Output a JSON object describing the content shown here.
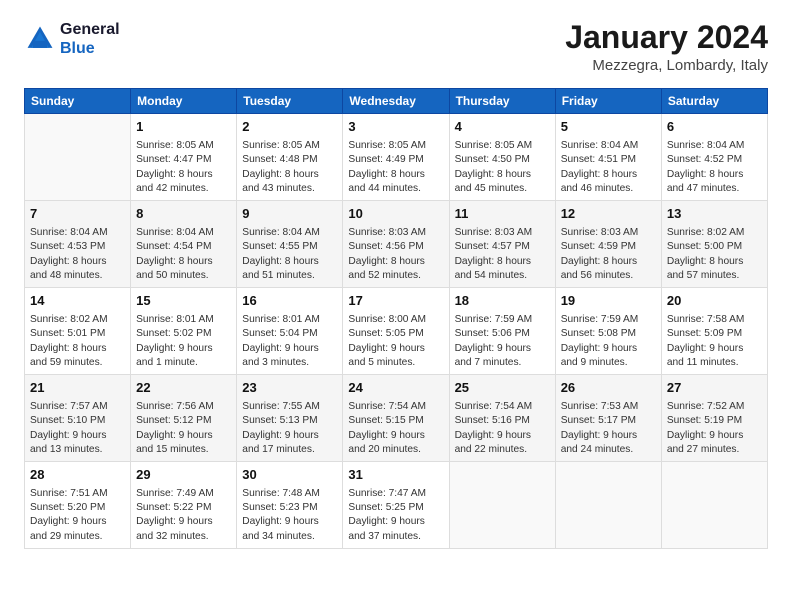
{
  "logo": {
    "line1": "General",
    "line2": "Blue"
  },
  "title": "January 2024",
  "location": "Mezzegra, Lombardy, Italy",
  "weekdays": [
    "Sunday",
    "Monday",
    "Tuesday",
    "Wednesday",
    "Thursday",
    "Friday",
    "Saturday"
  ],
  "weeks": [
    [
      {
        "day": "",
        "info": ""
      },
      {
        "day": "1",
        "info": "Sunrise: 8:05 AM\nSunset: 4:47 PM\nDaylight: 8 hours\nand 42 minutes."
      },
      {
        "day": "2",
        "info": "Sunrise: 8:05 AM\nSunset: 4:48 PM\nDaylight: 8 hours\nand 43 minutes."
      },
      {
        "day": "3",
        "info": "Sunrise: 8:05 AM\nSunset: 4:49 PM\nDaylight: 8 hours\nand 44 minutes."
      },
      {
        "day": "4",
        "info": "Sunrise: 8:05 AM\nSunset: 4:50 PM\nDaylight: 8 hours\nand 45 minutes."
      },
      {
        "day": "5",
        "info": "Sunrise: 8:04 AM\nSunset: 4:51 PM\nDaylight: 8 hours\nand 46 minutes."
      },
      {
        "day": "6",
        "info": "Sunrise: 8:04 AM\nSunset: 4:52 PM\nDaylight: 8 hours\nand 47 minutes."
      }
    ],
    [
      {
        "day": "7",
        "info": "Sunrise: 8:04 AM\nSunset: 4:53 PM\nDaylight: 8 hours\nand 48 minutes."
      },
      {
        "day": "8",
        "info": "Sunrise: 8:04 AM\nSunset: 4:54 PM\nDaylight: 8 hours\nand 50 minutes."
      },
      {
        "day": "9",
        "info": "Sunrise: 8:04 AM\nSunset: 4:55 PM\nDaylight: 8 hours\nand 51 minutes."
      },
      {
        "day": "10",
        "info": "Sunrise: 8:03 AM\nSunset: 4:56 PM\nDaylight: 8 hours\nand 52 minutes."
      },
      {
        "day": "11",
        "info": "Sunrise: 8:03 AM\nSunset: 4:57 PM\nDaylight: 8 hours\nand 54 minutes."
      },
      {
        "day": "12",
        "info": "Sunrise: 8:03 AM\nSunset: 4:59 PM\nDaylight: 8 hours\nand 56 minutes."
      },
      {
        "day": "13",
        "info": "Sunrise: 8:02 AM\nSunset: 5:00 PM\nDaylight: 8 hours\nand 57 minutes."
      }
    ],
    [
      {
        "day": "14",
        "info": "Sunrise: 8:02 AM\nSunset: 5:01 PM\nDaylight: 8 hours\nand 59 minutes."
      },
      {
        "day": "15",
        "info": "Sunrise: 8:01 AM\nSunset: 5:02 PM\nDaylight: 9 hours\nand 1 minute."
      },
      {
        "day": "16",
        "info": "Sunrise: 8:01 AM\nSunset: 5:04 PM\nDaylight: 9 hours\nand 3 minutes."
      },
      {
        "day": "17",
        "info": "Sunrise: 8:00 AM\nSunset: 5:05 PM\nDaylight: 9 hours\nand 5 minutes."
      },
      {
        "day": "18",
        "info": "Sunrise: 7:59 AM\nSunset: 5:06 PM\nDaylight: 9 hours\nand 7 minutes."
      },
      {
        "day": "19",
        "info": "Sunrise: 7:59 AM\nSunset: 5:08 PM\nDaylight: 9 hours\nand 9 minutes."
      },
      {
        "day": "20",
        "info": "Sunrise: 7:58 AM\nSunset: 5:09 PM\nDaylight: 9 hours\nand 11 minutes."
      }
    ],
    [
      {
        "day": "21",
        "info": "Sunrise: 7:57 AM\nSunset: 5:10 PM\nDaylight: 9 hours\nand 13 minutes."
      },
      {
        "day": "22",
        "info": "Sunrise: 7:56 AM\nSunset: 5:12 PM\nDaylight: 9 hours\nand 15 minutes."
      },
      {
        "day": "23",
        "info": "Sunrise: 7:55 AM\nSunset: 5:13 PM\nDaylight: 9 hours\nand 17 minutes."
      },
      {
        "day": "24",
        "info": "Sunrise: 7:54 AM\nSunset: 5:15 PM\nDaylight: 9 hours\nand 20 minutes."
      },
      {
        "day": "25",
        "info": "Sunrise: 7:54 AM\nSunset: 5:16 PM\nDaylight: 9 hours\nand 22 minutes."
      },
      {
        "day": "26",
        "info": "Sunrise: 7:53 AM\nSunset: 5:17 PM\nDaylight: 9 hours\nand 24 minutes."
      },
      {
        "day": "27",
        "info": "Sunrise: 7:52 AM\nSunset: 5:19 PM\nDaylight: 9 hours\nand 27 minutes."
      }
    ],
    [
      {
        "day": "28",
        "info": "Sunrise: 7:51 AM\nSunset: 5:20 PM\nDaylight: 9 hours\nand 29 minutes."
      },
      {
        "day": "29",
        "info": "Sunrise: 7:49 AM\nSunset: 5:22 PM\nDaylight: 9 hours\nand 32 minutes."
      },
      {
        "day": "30",
        "info": "Sunrise: 7:48 AM\nSunset: 5:23 PM\nDaylight: 9 hours\nand 34 minutes."
      },
      {
        "day": "31",
        "info": "Sunrise: 7:47 AM\nSunset: 5:25 PM\nDaylight: 9 hours\nand 37 minutes."
      },
      {
        "day": "",
        "info": ""
      },
      {
        "day": "",
        "info": ""
      },
      {
        "day": "",
        "info": ""
      }
    ]
  ]
}
